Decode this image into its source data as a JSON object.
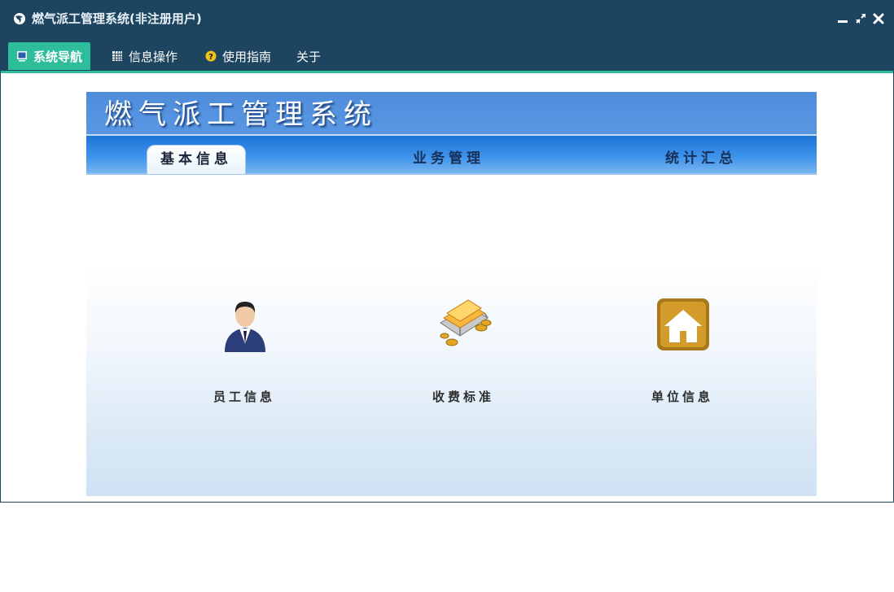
{
  "window": {
    "title": "燃气派工管理系统(非注册用户)",
    "controls": [
      "minimize-icon",
      "restore-icon",
      "close-icon"
    ]
  },
  "menu": {
    "items": [
      {
        "label": "系统导航",
        "icon": "monitor-icon",
        "active": true
      },
      {
        "label": "信息操作",
        "icon": "grid-icon",
        "active": false
      },
      {
        "label": "使用指南",
        "icon": "help-icon",
        "active": false
      },
      {
        "label": "关于",
        "icon": "",
        "active": false
      }
    ]
  },
  "banner": {
    "title": "燃气派工管理系统"
  },
  "tabs": [
    {
      "label": "基本信息",
      "active": true
    },
    {
      "label": "业务管理",
      "active": false
    },
    {
      "label": "统计汇总",
      "active": false
    }
  ],
  "tiles": [
    {
      "label": "员工信息",
      "icon": "employee-icon"
    },
    {
      "label": "收费标准",
      "icon": "money-icon"
    },
    {
      "label": "单位信息",
      "icon": "home-icon"
    }
  ],
  "colors": {
    "titlebar": "#1e4560",
    "accent": "#2ebd9a",
    "banner": "#4f8ddc",
    "tabbar": "#1c74d6"
  }
}
